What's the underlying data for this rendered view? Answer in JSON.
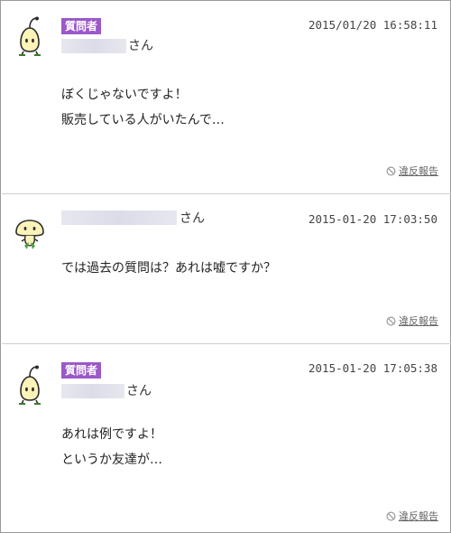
{
  "posts": [
    {
      "is_asker": true,
      "badge": "質問者",
      "honorific": "さん",
      "timestamp": "2015/01/20  16:58:11",
      "lines": [
        "ぼくじゃないですよ！",
        "販売している人がいたんで…"
      ],
      "report": "違反報告"
    },
    {
      "is_asker": false,
      "badge": "",
      "honorific": "さん",
      "timestamp": "2015-01-20 17:03:50",
      "lines": [
        "では過去の質問は？あれは嘘ですか？"
      ],
      "report": "違反報告"
    },
    {
      "is_asker": true,
      "badge": "質問者",
      "honorific": "さん",
      "timestamp": "2015-01-20 17:05:38",
      "lines": [
        "あれは例ですよ！",
        "というか友達が…"
      ],
      "report": "違反報告"
    }
  ],
  "icons": {
    "asker_avatar": "sprout-character-icon",
    "user_avatar": "mushroom-character-icon",
    "report": "no-entry-icon"
  },
  "colors": {
    "badge": "#9b59c9",
    "separator": "#cfcfcf",
    "name_placeholder": "#e0e0ea"
  }
}
